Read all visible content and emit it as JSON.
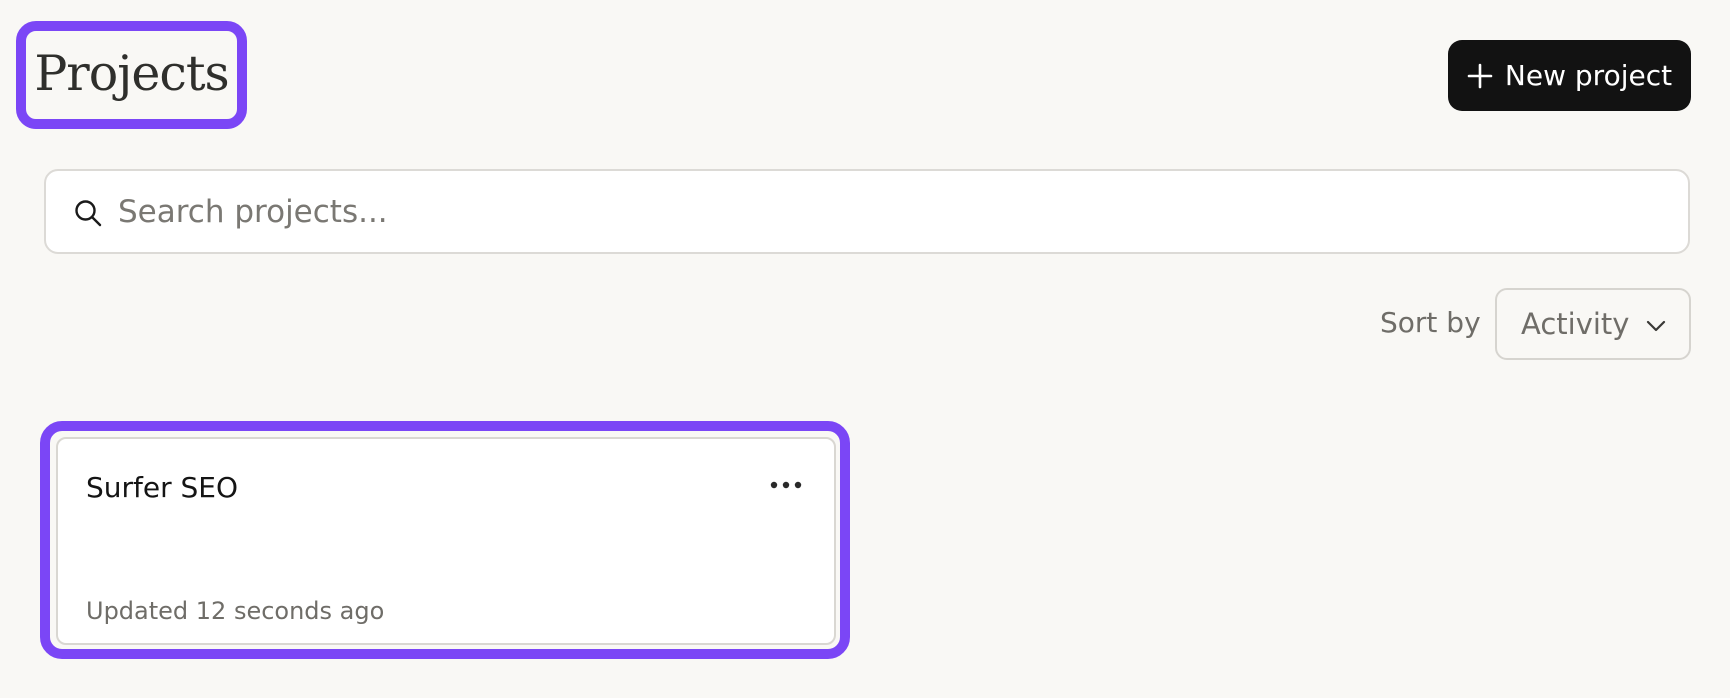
{
  "header": {
    "title": "Projects",
    "new_project_label": "New project",
    "new_project_icon": "plus-icon"
  },
  "search": {
    "placeholder": "Search projects...",
    "value": "",
    "icon": "search-icon"
  },
  "sort": {
    "label": "Sort by",
    "selected": "Activity",
    "icon": "chevron-down-icon"
  },
  "projects": [
    {
      "name": "Surfer SEO",
      "updated": "Updated 12 seconds ago",
      "menu_icon": "more-horizontal-icon"
    }
  ],
  "colors": {
    "background": "#f9f8f5",
    "highlight": "#7b46f6",
    "button_bg": "#121212",
    "muted_text": "#6f6d68"
  }
}
